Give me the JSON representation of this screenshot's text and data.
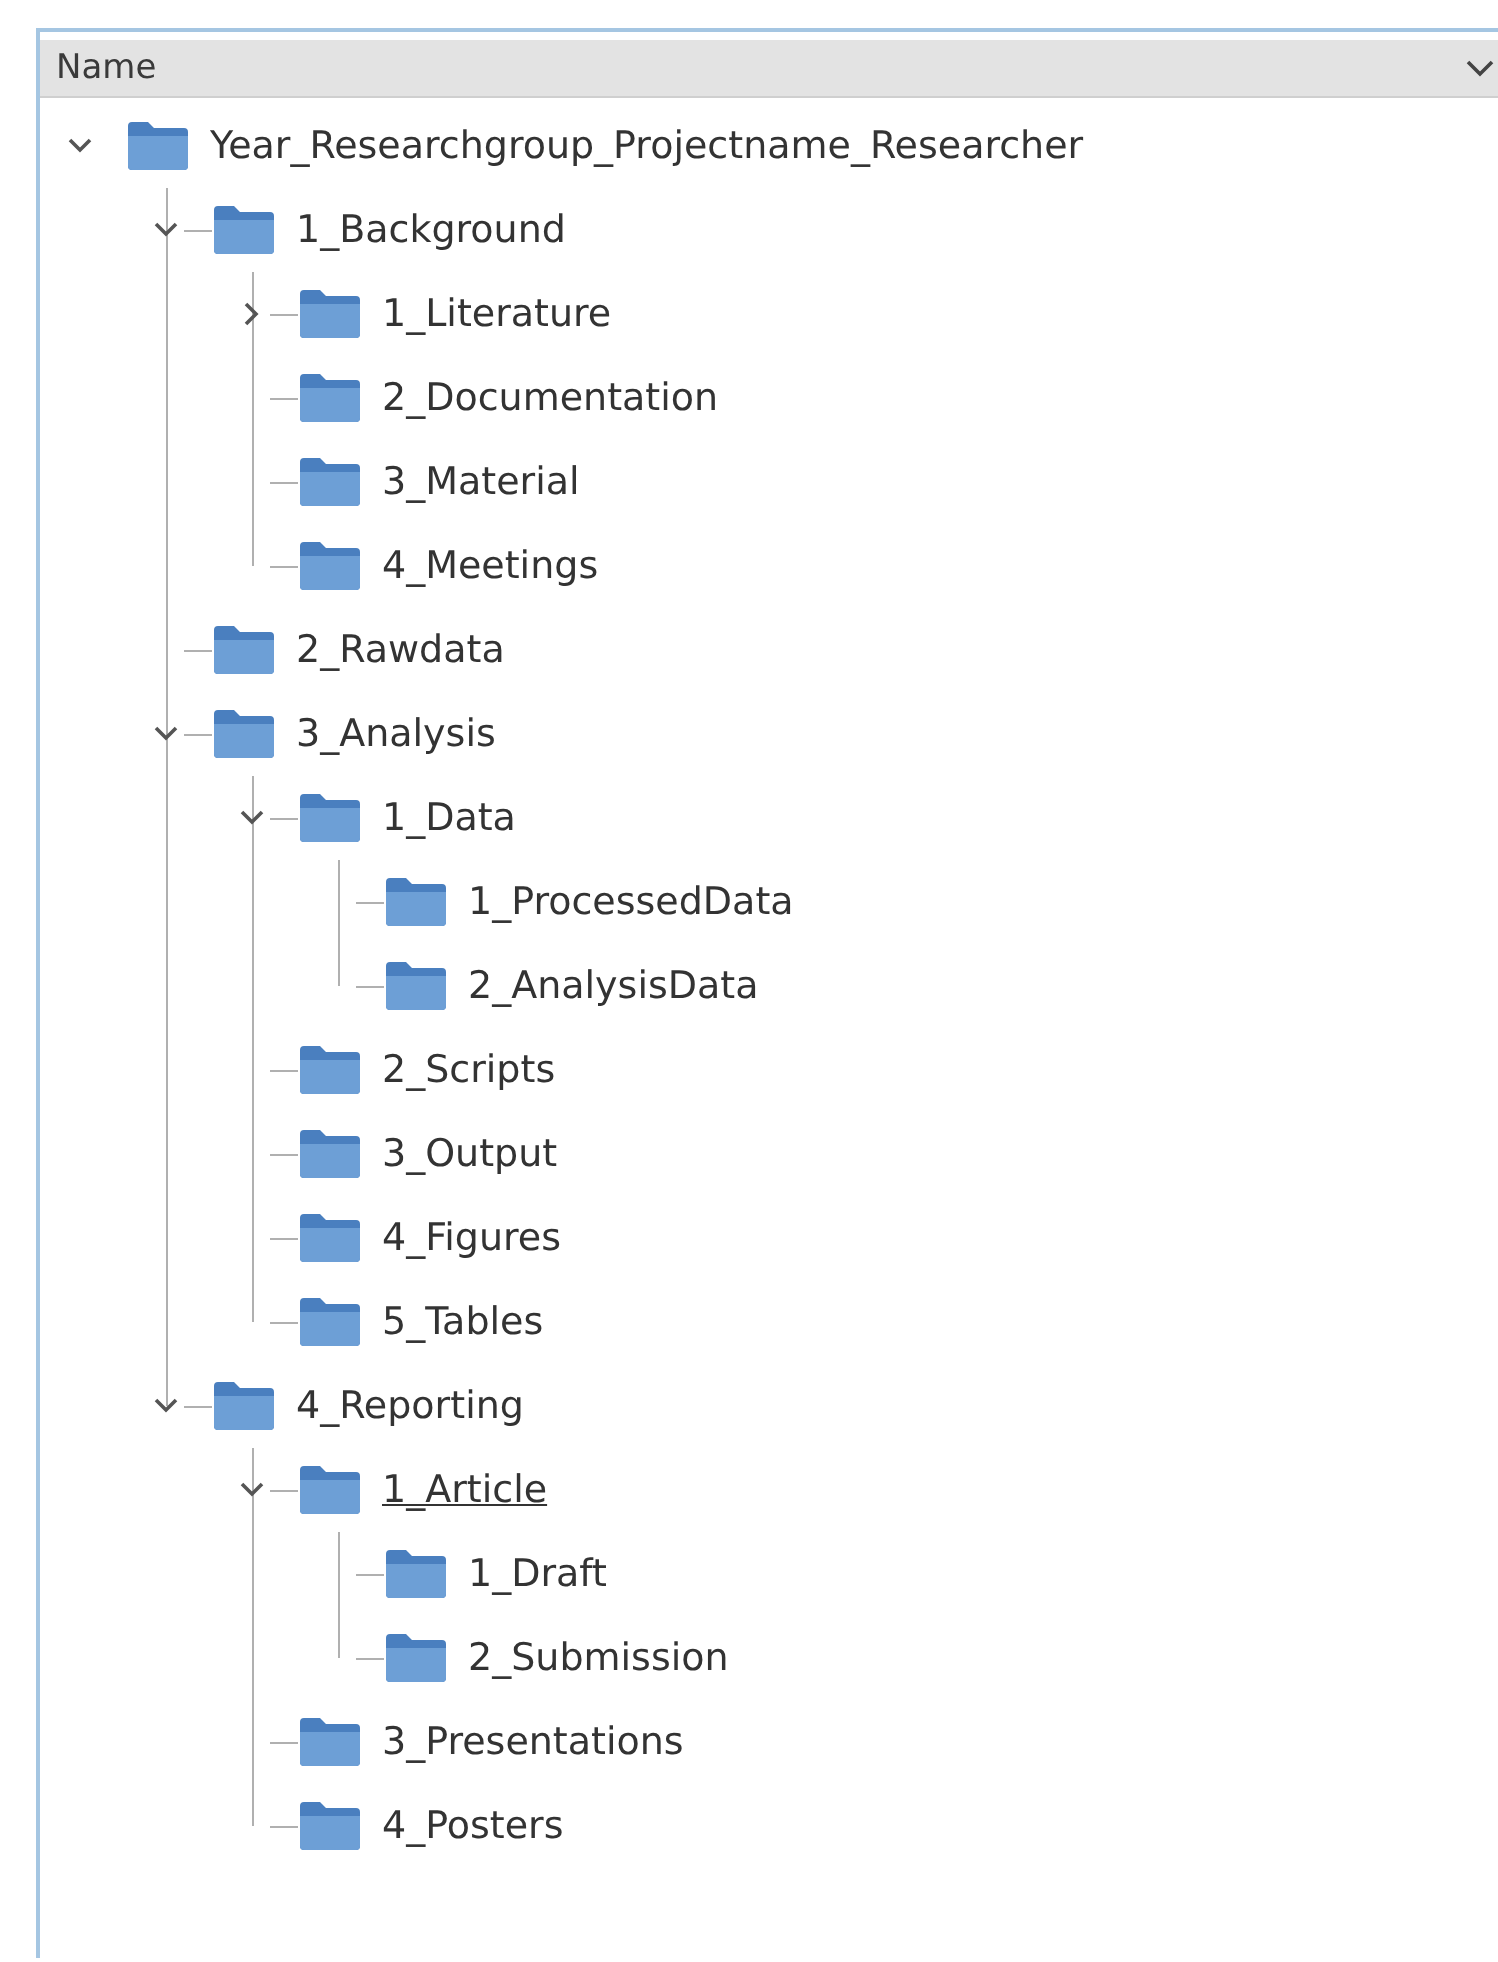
{
  "header": {
    "label": "Name"
  },
  "tree": {
    "name": "Year_Researchgroup_Projectname_Researcher",
    "expanded": true,
    "hovered": false,
    "children": [
      {
        "name": "1_Background",
        "expanded": true,
        "hovered": false,
        "children": [
          {
            "name": "1_Literature",
            "expanded": false,
            "hovered": false
          },
          {
            "name": "2_Documentation",
            "hovered": false
          },
          {
            "name": "3_Material",
            "hovered": false
          },
          {
            "name": "4_Meetings",
            "hovered": false
          }
        ]
      },
      {
        "name": "2_Rawdata",
        "hovered": false
      },
      {
        "name": "3_Analysis",
        "expanded": true,
        "hovered": false,
        "children": [
          {
            "name": "1_Data",
            "expanded": true,
            "hovered": false,
            "children": [
              {
                "name": "1_ProcessedData",
                "hovered": false
              },
              {
                "name": "2_AnalysisData",
                "hovered": false
              }
            ]
          },
          {
            "name": "2_Scripts",
            "hovered": false
          },
          {
            "name": "3_Output",
            "hovered": false
          },
          {
            "name": "4_Figures",
            "hovered": false
          },
          {
            "name": "5_Tables",
            "hovered": false
          }
        ]
      },
      {
        "name": "4_Reporting",
        "expanded": true,
        "hovered": false,
        "children": [
          {
            "name": "1_Article",
            "expanded": true,
            "hovered": true,
            "children": [
              {
                "name": "1_Draft",
                "hovered": false
              },
              {
                "name": "2_Submission",
                "hovered": false
              }
            ]
          },
          {
            "name": "3_Presentations",
            "hovered": false
          },
          {
            "name": "4_Posters",
            "hovered": false
          }
        ]
      }
    ]
  }
}
